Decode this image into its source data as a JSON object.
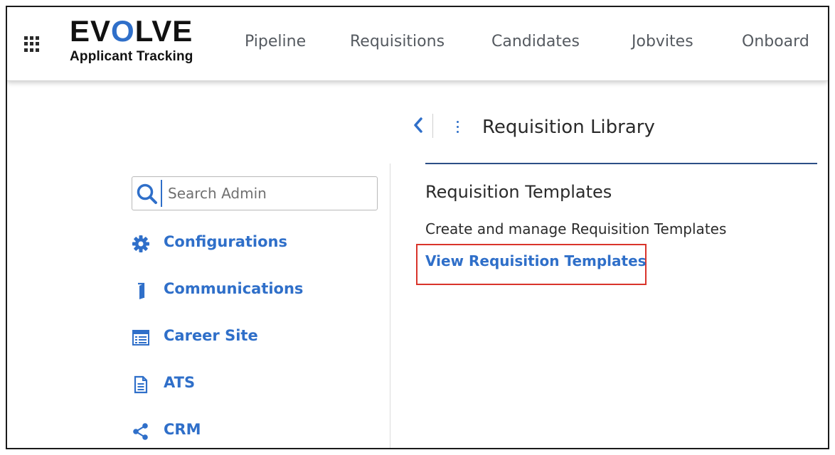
{
  "header": {
    "logo": {
      "part1": "EV",
      "part2": "O",
      "part3": "LVE",
      "subtitle": "Applicant Tracking"
    },
    "nav": [
      {
        "label": "Pipeline"
      },
      {
        "label": "Requisitions"
      },
      {
        "label": "Candidates"
      },
      {
        "label": "Jobvites"
      },
      {
        "label": "Onboard"
      }
    ]
  },
  "sidebar": {
    "search": {
      "placeholder": "Search Admin",
      "value": ""
    },
    "items": [
      {
        "label": "Configurations",
        "icon": "gear-icon"
      },
      {
        "label": "Communications",
        "icon": "door-icon"
      },
      {
        "label": "Career Site",
        "icon": "webpage-icon"
      },
      {
        "label": "ATS",
        "icon": "document-icon"
      },
      {
        "label": "CRM",
        "icon": "share-icon"
      }
    ]
  },
  "content": {
    "page_title": "Requisition Library",
    "section": {
      "title": "Requisition Templates",
      "description": "Create and manage Requisition Templates",
      "link_label": "View Requisition Templates"
    }
  },
  "colors": {
    "accent": "#2f6fc9",
    "highlight": "#d9342b",
    "rule": "#2c4f86",
    "text": "#2a2a2a"
  }
}
